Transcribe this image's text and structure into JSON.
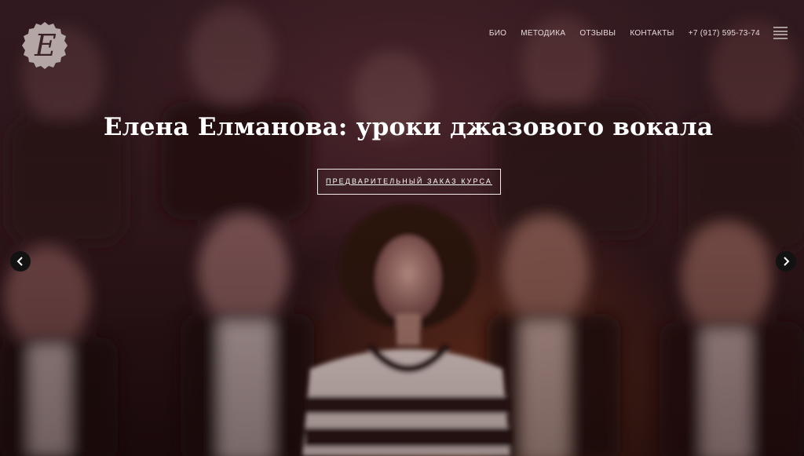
{
  "brand": {
    "logo_letter": "Е",
    "icon": "logo-seal"
  },
  "nav": {
    "items": [
      {
        "label": "БИО"
      },
      {
        "label": "МЕТОДИКА"
      },
      {
        "label": "ОТЗЫВЫ"
      },
      {
        "label": "КОНТАКТЫ"
      }
    ],
    "phone": "+7 (917) 595-73-74",
    "menu_icon": "hamburger-icon"
  },
  "hero": {
    "title": "Елена Елманова: уроки джазового вокала",
    "cta_label": "ПРЕДВАРИТЕЛЬНЫЙ ЗАКАЗ КУРСА",
    "prev_icon": "chevron-left-icon",
    "next_icon": "chevron-right-icon"
  },
  "colors": {
    "accent": "#ffffff",
    "overlay": "#3a1e24",
    "logo": "#b5a6a6"
  }
}
